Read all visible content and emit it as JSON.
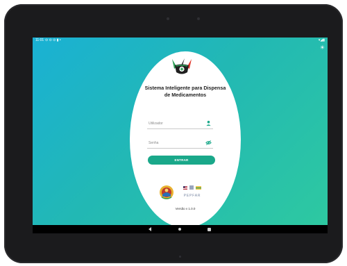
{
  "status_bar": {
    "time": "11:01",
    "left_icons": "⊙ ⊙ ⊙ ▮ •",
    "right_icons": "▾◢▮"
  },
  "app": {
    "title_line1": "Sistema Inteligente para Dispensa",
    "title_line2": "de Medicamentos",
    "username": {
      "placeholder": "Utilizador",
      "value": ""
    },
    "password": {
      "placeholder": "Senha",
      "value": ""
    },
    "login_button": "ENTRAR",
    "partner_logo_text": "PEPFAR",
    "version": "Versão v 1.0.0"
  },
  "colors": {
    "gradient_start": "#1ab1d4",
    "gradient_end": "#2ec9a0",
    "accent": "#1aa88a"
  },
  "icons": {
    "app_logo": "mortar-pestle-cross-icon",
    "username": "person-icon",
    "password": "eye-off-icon",
    "brightness": "sun-icon",
    "emblem": "mozambique-emblem-icon",
    "partner": "pepfar-logo"
  }
}
